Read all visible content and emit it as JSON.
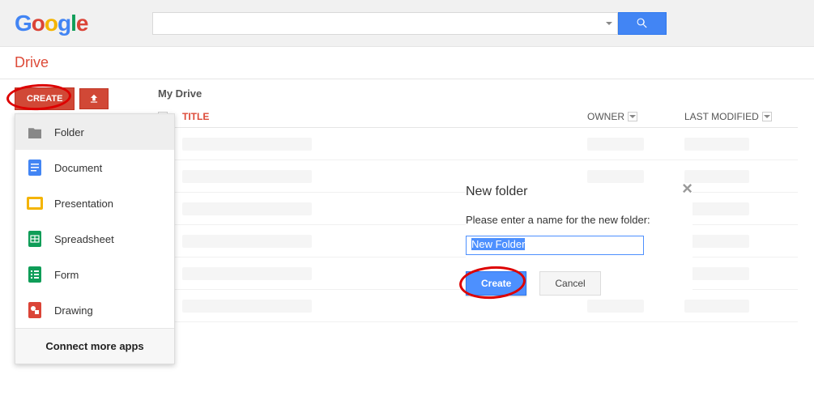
{
  "header": {
    "logo_letters": [
      "G",
      "o",
      "o",
      "g",
      "l",
      "e"
    ],
    "search_value": ""
  },
  "app": {
    "title": "Drive"
  },
  "sidebar": {
    "create_label": "CREATE",
    "menu_items": [
      {
        "label": "Folder",
        "icon": "folder",
        "highlighted": true
      },
      {
        "label": "Document",
        "icon": "document",
        "highlighted": false
      },
      {
        "label": "Presentation",
        "icon": "presentation",
        "highlighted": false
      },
      {
        "label": "Spreadsheet",
        "icon": "spreadsheet",
        "highlighted": false
      },
      {
        "label": "Form",
        "icon": "form",
        "highlighted": false
      },
      {
        "label": "Drawing",
        "icon": "drawing",
        "highlighted": false
      }
    ],
    "connect_label": "Connect more apps"
  },
  "content": {
    "breadcrumb": "My Drive",
    "columns": {
      "title": "TITLE",
      "owner": "OWNER",
      "last_modified": "LAST MODIFIED"
    },
    "row_count": 6
  },
  "dialog": {
    "title": "New folder",
    "prompt": "Please enter a name for the new folder:",
    "input_value": "New Folder",
    "create_label": "Create",
    "cancel_label": "Cancel"
  }
}
